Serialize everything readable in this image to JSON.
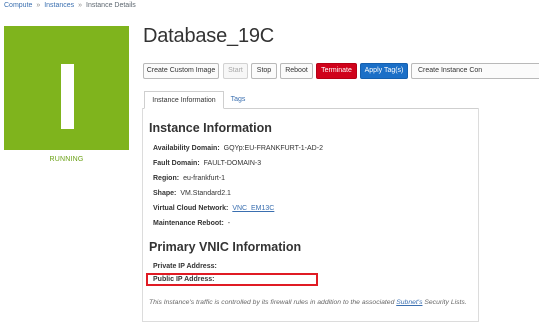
{
  "breadcrumb": {
    "items": [
      "Compute",
      "Instances"
    ],
    "separator": "»",
    "current": "Instance Details"
  },
  "instance": {
    "name": "Database_19C",
    "state": "RUNNING",
    "icon": "instance-icon",
    "state_color": "#7fb41d"
  },
  "actions": {
    "create_custom_image": "Create Custom Image",
    "start": "Start",
    "stop": "Stop",
    "reboot": "Reboot",
    "terminate": "Terminate",
    "apply_tags": "Apply Tag(s)",
    "create_instance_config": "Create Instance Con"
  },
  "tabs": {
    "info": "Instance Information",
    "tags": "Tags"
  },
  "info": {
    "heading": "Instance Information",
    "availability_domain": {
      "label": "Availability Domain:",
      "value": "GQYp:EU-FRANKFURT-1-AD-2"
    },
    "fault_domain": {
      "label": "Fault Domain:",
      "value": "FAULT-DOMAIN-3"
    },
    "region": {
      "label": "Region:",
      "value": "eu-frankfurt-1"
    },
    "shape": {
      "label": "Shape:",
      "value": "VM.Standard2.1"
    },
    "vcn": {
      "label": "Virtual Cloud Network:",
      "value": "VNC_EM13C"
    },
    "maintenance_reboot": {
      "label": "Maintenance Reboot:",
      "value": "-"
    }
  },
  "vnic": {
    "heading": "Primary VNIC Information",
    "private_ip": {
      "label": "Private IP Address:",
      "value": ""
    },
    "public_ip": {
      "label": "Public IP Address:",
      "value": ""
    },
    "note_before": "This Instance's traffic is controlled by its firewall rules in addition to the associated ",
    "note_link": "Subnet's",
    "note_after": " Security Lists."
  },
  "colors": {
    "accent": "#1b6fc7",
    "danger": "#d0021b",
    "highlight": "#e01b24"
  }
}
